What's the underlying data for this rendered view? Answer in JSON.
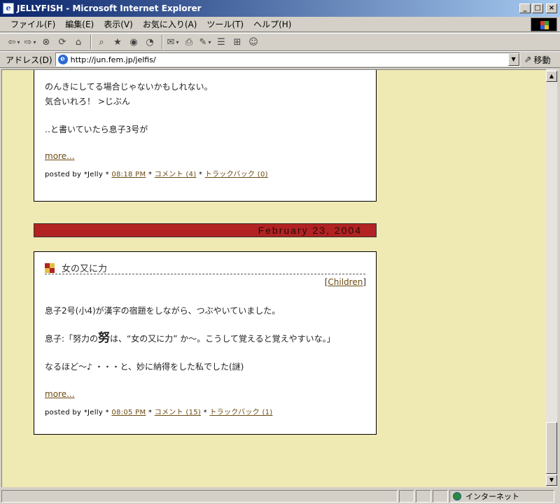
{
  "window": {
    "title": "JELLYFISH - Microsoft Internet Explorer",
    "app_icon": "ie-page-icon",
    "minimize_glyph": "_",
    "maximize_glyph": "□",
    "close_glyph": "×"
  },
  "menu": {
    "items": [
      {
        "label": "ファイル(F)"
      },
      {
        "label": "編集(E)"
      },
      {
        "label": "表示(V)"
      },
      {
        "label": "お気に入り(A)"
      },
      {
        "label": "ツール(T)"
      },
      {
        "label": "ヘルプ(H)"
      }
    ]
  },
  "toolbar": {
    "back_glyph": "⇦",
    "forward_glyph": "⇨",
    "stop_glyph": "⊗",
    "refresh_glyph": "⟳",
    "home_glyph": "⌂",
    "search_glyph": "⌕",
    "favorites_glyph": "★",
    "history_glyph": "◔",
    "media_glyph": "◉",
    "mail_glyph": "✉",
    "print_glyph": "⎙",
    "edit_glyph": "✎",
    "discuss_glyph": "☰",
    "research_glyph": "⊞",
    "messenger_glyph": "☺"
  },
  "address": {
    "label": "アドレス(D)",
    "url": "http://jun.fem.jp/jelfis/",
    "go_label": "移動",
    "go_glyph": "⇗"
  },
  "posts": [
    {
      "lines": [
        "のんきにしてる場合じゃないかもしれない。",
        "気合いれろ！ >じぶん",
        "",
        "‥と書いていたら息子3号が"
      ],
      "more": "more...",
      "posted_prefix": "posted by *Jelly * ",
      "time": "08:18 PM",
      "sep1": " * ",
      "comments": "コメント (4)",
      "sep2": " * ",
      "trackbacks": "トラックバック (0)"
    },
    {
      "date": "February 23, 2004",
      "title": "女の又に力",
      "category_open": "[",
      "category": "Children",
      "category_close": "]",
      "line1": "息子2号(小4)が漢字の宿題をしながら、つぶやいていました。",
      "line2_pre": "息子:「努力の",
      "line2_big": "努",
      "line2_post": "は、“女の又に力” か～。こうして覚えると覚えやすいな。」",
      "line3": "なるほど～♪ ・・・と、妙に納得をした私でした(謎)",
      "more": "more...",
      "posted_prefix": "posted by *Jelly * ",
      "time": "08:05 PM",
      "sep1": " * ",
      "comments": "コメント (15)",
      "sep2": " * ",
      "trackbacks": "トラックバック (1)"
    }
  ],
  "scrollbar": {
    "up_glyph": "▲",
    "down_glyph": "▼"
  },
  "status": {
    "zone": "インターネット"
  },
  "colors": {
    "page_bg": "#efe9b3",
    "date_bar": "#b22222",
    "link": "#6b4a10"
  }
}
